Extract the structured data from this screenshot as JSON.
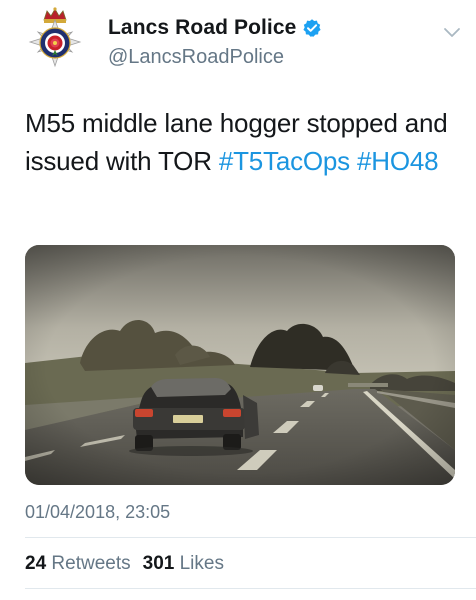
{
  "author": {
    "display_name": "Lancs Road Police",
    "handle": "@LancsRoadPolice",
    "verified": true
  },
  "tweet": {
    "text_plain": "M55 middle lane hogger stopped and issued with TOR",
    "hashtags": [
      "#T5TacOps",
      "#HO48"
    ],
    "timestamp": "01/04/2018, 23:05"
  },
  "stats": {
    "retweets_count": "24",
    "retweets_label": "Retweets",
    "likes_count": "301",
    "likes_label": "Likes"
  },
  "colors": {
    "link": "#1b95e0",
    "muted": "#657786",
    "divider": "#e1e8ed",
    "verified": "#1da1f2"
  },
  "icons": {
    "avatar": "lancashire-constabulary-crest-icon",
    "verified": "verified-badge-icon",
    "menu": "chevron-down-icon"
  }
}
